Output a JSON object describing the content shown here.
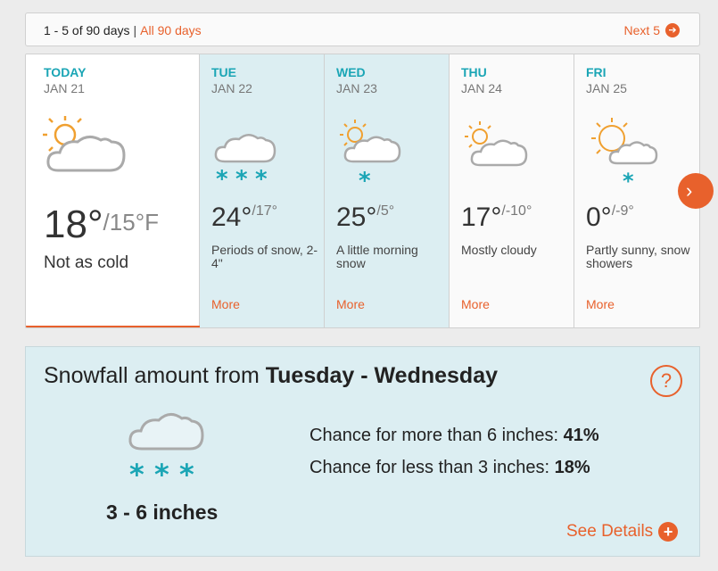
{
  "topbar": {
    "range_text": "1 - 5 of 90 days",
    "separator": "|",
    "all_link": "All 90 days",
    "next_label": "Next 5",
    "next_icon": "arrow-right-circle-icon"
  },
  "days": [
    {
      "name": "TODAY",
      "date": "JAN 21",
      "high": "18°",
      "low": "/15°F",
      "desc": "Not as cold",
      "icon": "sun-cloud-icon",
      "selected": true
    },
    {
      "name": "TUE",
      "date": "JAN 22",
      "high": "24°",
      "low": "/17°",
      "desc": "Periods of snow, 2-4\"",
      "more": "More",
      "icon": "cloud-snow-icon"
    },
    {
      "name": "WED",
      "date": "JAN 23",
      "high": "25°",
      "low": "/5°",
      "desc": "A little morning snow",
      "more": "More",
      "icon": "sun-cloud-snow-icon"
    },
    {
      "name": "THU",
      "date": "JAN 24",
      "high": "17°",
      "low": "/-10°",
      "desc": "Mostly cloudy",
      "more": "More",
      "icon": "sun-cloud-icon"
    },
    {
      "name": "FRI",
      "date": "JAN 25",
      "high": "0°",
      "low": "/-9°",
      "desc": "Partly sunny, snow showers",
      "more": "More",
      "icon": "sun-cloud-snow-icon"
    }
  ],
  "snowfall": {
    "title_prefix": "Snowfall amount from",
    "title_range": "Tuesday - Wednesday",
    "amount": "3 - 6 inches",
    "chance_more_label": "Chance for more than 6 inches:",
    "chance_more_value": "41%",
    "chance_less_label": "Chance for less than 3 inches:",
    "chance_less_value": "18%",
    "details_label": "See Details",
    "help_symbol": "?"
  },
  "colors": {
    "accent": "#e8612c",
    "teal": "#1aa5b5",
    "snow_bg": "#dceef2"
  }
}
